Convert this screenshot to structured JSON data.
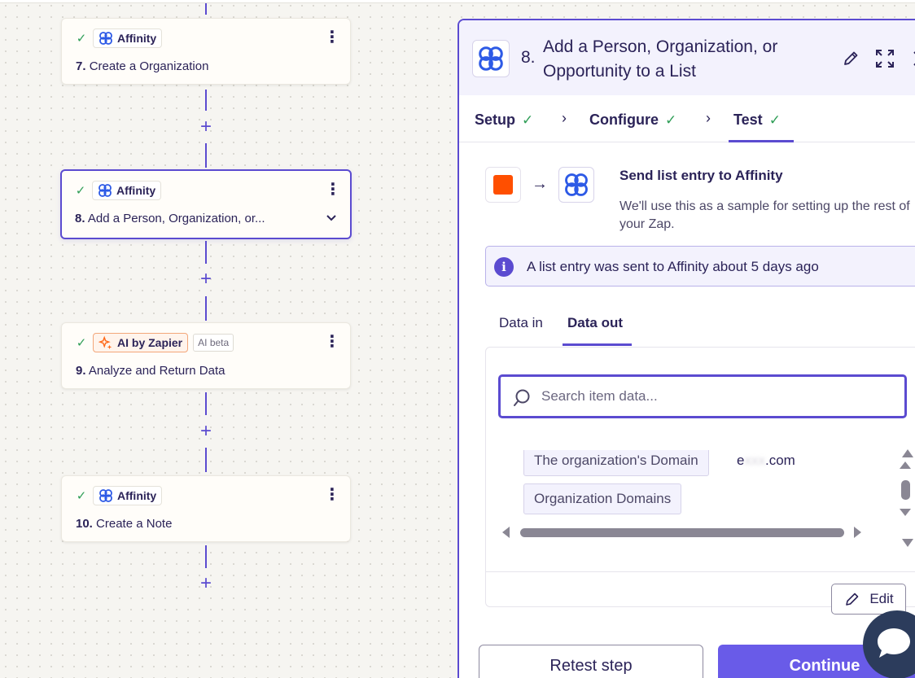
{
  "colors": {
    "accent": "#5b4bd0",
    "success": "#2f9e57",
    "affinity_brand": "#2d5ae6",
    "trigger_orange": "#ff4f00",
    "continue_button": "#695be8"
  },
  "workflow": {
    "steps": [
      {
        "number": "7.",
        "app": "Affinity",
        "app_icon": "affinity-logo-icon",
        "title": "Create a Organization",
        "status": "success"
      },
      {
        "number": "8.",
        "app": "Affinity",
        "app_icon": "affinity-logo-icon",
        "title": "Add a Person, Organization, or...",
        "status": "success",
        "selected": true
      },
      {
        "number": "9.",
        "app": "AI by Zapier",
        "app_icon": "sparkle-icon",
        "badge": "AI beta",
        "title": "Analyze and Return Data",
        "status": "success"
      },
      {
        "number": "10.",
        "app": "Affinity",
        "app_icon": "affinity-logo-icon",
        "title": "Create a Note",
        "status": "success"
      }
    ],
    "add_step_glyph": "+"
  },
  "panel": {
    "step_number": "8.",
    "title": "Add a Person, Organization, or Opportunity to a List",
    "tabs": [
      {
        "label": "Setup",
        "done": true
      },
      {
        "label": "Configure",
        "done": true
      },
      {
        "label": "Test",
        "done": true,
        "active": true
      }
    ],
    "send": {
      "title": "Send list entry to Affinity",
      "description": "We'll use this as a sample for setting up the rest of your Zap."
    },
    "info": "A list entry was sent to Affinity about 5 days ago",
    "data_tabs": [
      {
        "label": "Data in"
      },
      {
        "label": "Data out",
        "active": true
      }
    ],
    "search": {
      "placeholder": "Search item data...",
      "value": ""
    },
    "fields": [
      {
        "label": "The organization's Domain",
        "value_prefix": "e",
        "value_hidden": "xxx",
        "value_suffix": ".com"
      },
      {
        "label": "Organization Domains"
      }
    ],
    "edit_label": "Edit",
    "retest_label": "Retest step",
    "continue_label": "Continue"
  }
}
